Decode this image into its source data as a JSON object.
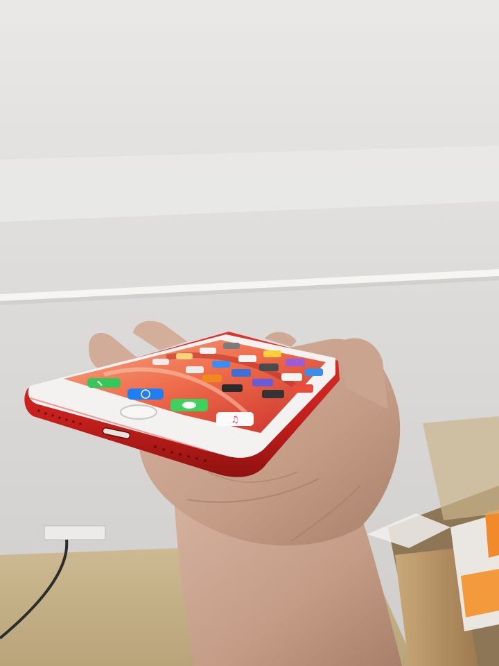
{
  "scene": {
    "subject": "red-iphone-held-in-hand",
    "colors": {
      "wall": "#e4e3e1",
      "wall_lower": "#d3d3d2",
      "floor": "#c7b48a",
      "phone_red": "#c8201e",
      "phone_red_dark": "#9e1412",
      "phone_face": "#f3f1ef",
      "screen_wallpaper_a": "#f07a52",
      "screen_wallpaper_b": "#d83a2e",
      "skin": "#c9a591",
      "skin_shadow": "#a8806a",
      "box_brown": "#b08a5e",
      "box_orange": "#f08a2a"
    },
    "icons": [
      "phone-icon",
      "safari-icon",
      "messages-icon",
      "music-icon"
    ]
  }
}
